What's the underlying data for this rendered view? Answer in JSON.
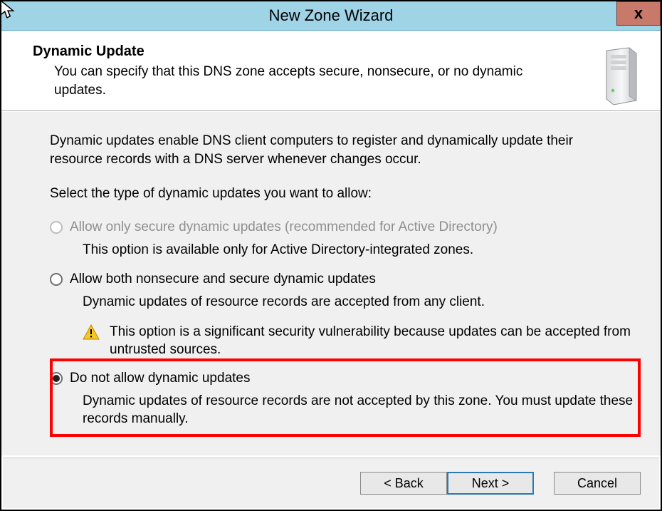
{
  "window": {
    "title": "New Zone Wizard",
    "close_label": "x"
  },
  "header": {
    "heading": "Dynamic Update",
    "subheading": "You can specify that this DNS zone accepts secure, nonsecure, or no dynamic updates."
  },
  "intro": {
    "paragraph1": "Dynamic updates enable DNS client computers to register and dynamically update their resource records with a DNS server whenever changes occur.",
    "paragraph2": "Select the type of dynamic updates you want to allow:"
  },
  "options": [
    {
      "label": "Allow only secure dynamic updates (recommended for Active Directory)",
      "description": "This option is available only for Active Directory-integrated zones.",
      "disabled": true,
      "selected": false,
      "warning": null
    },
    {
      "label": "Allow both nonsecure and secure dynamic updates",
      "description": "Dynamic updates of resource records are accepted from any client.",
      "disabled": false,
      "selected": false,
      "warning": "This option is a significant security vulnerability because updates can be accepted from untrusted sources."
    },
    {
      "label": "Do not allow dynamic updates",
      "description": "Dynamic updates of resource records are not accepted by this zone. You must update these records manually.",
      "disabled": false,
      "selected": true,
      "warning": null
    }
  ],
  "buttons": {
    "back": "< Back",
    "next": "Next >",
    "cancel": "Cancel"
  }
}
